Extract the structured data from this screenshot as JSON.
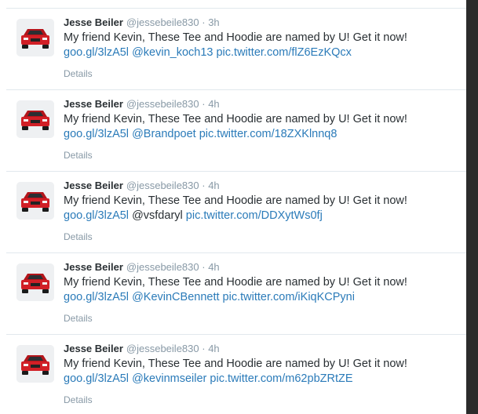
{
  "colors": {
    "link": "#2b7bb9",
    "text": "#292f33",
    "muted": "#8899a6",
    "divider": "#e1e8ed"
  },
  "tweets": [
    {
      "fullname": "Jesse Beiler",
      "username": "@jessebeile830",
      "separator": "·",
      "time": "3h",
      "text": "My friend Kevin, These Tee and Hoodie are named by U! Get it now!",
      "short_link": "goo.gl/3lzA5l",
      "mention": "@kevin_koch13",
      "mention_is_link": true,
      "pic_link": "pic.twitter.com/flZ6EzKQcx",
      "details": "Details",
      "avatar_icon": "red-car-avatar-icon"
    },
    {
      "fullname": "Jesse Beiler",
      "username": "@jessebeile830",
      "separator": "·",
      "time": "4h",
      "text": "My friend Kevin, These Tee and Hoodie are named by U! Get it now!",
      "short_link": "goo.gl/3lzA5l",
      "mention": "@Brandpoet",
      "mention_is_link": true,
      "pic_link": "pic.twitter.com/18ZXKlnnq8",
      "details": "Details",
      "avatar_icon": "red-car-avatar-icon"
    },
    {
      "fullname": "Jesse Beiler",
      "username": "@jessebeile830",
      "separator": "·",
      "time": "4h",
      "text": "My friend Kevin, These Tee and Hoodie are named by U! Get it now!",
      "short_link": "goo.gl/3lzA5l",
      "mention": "@vsfdaryl",
      "mention_is_link": false,
      "pic_link": "pic.twitter.com/DDXytWs0fj",
      "details": "Details",
      "avatar_icon": "red-car-avatar-icon"
    },
    {
      "fullname": "Jesse Beiler",
      "username": "@jessebeile830",
      "separator": "·",
      "time": "4h",
      "text": "My friend Kevin, These Tee and Hoodie are named by U! Get it now!",
      "short_link": "goo.gl/3lzA5l",
      "mention": "@KevinCBennett",
      "mention_is_link": true,
      "pic_link": "pic.twitter.com/iKiqKCPyni",
      "details": "Details",
      "avatar_icon": "red-car-avatar-icon"
    },
    {
      "fullname": "Jesse Beiler",
      "username": "@jessebeile830",
      "separator": "·",
      "time": "4h",
      "text": "My friend Kevin, These Tee and Hoodie are named by U! Get it now!",
      "short_link": "goo.gl/3lzA5l",
      "mention": "@kevinmseiler",
      "mention_is_link": true,
      "pic_link": "pic.twitter.com/m62pbZRtZE",
      "details": "Details",
      "avatar_icon": "red-car-avatar-icon"
    }
  ]
}
